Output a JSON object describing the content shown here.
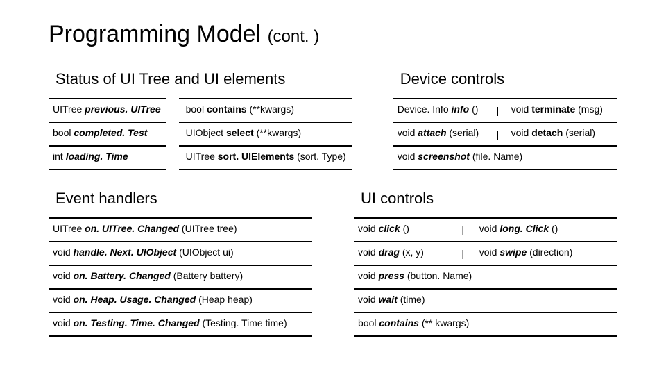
{
  "title_main": "Programming Model ",
  "title_cont": "(cont. )",
  "sections": {
    "status_title": "Status of UI Tree and UI elements",
    "device_title": "Device controls",
    "event_title": "Event handlers",
    "uicontrols_title": "UI controls"
  },
  "status": [
    {
      "l_pre": "UITree ",
      "l_bi": "previous. UITree",
      "l_post": "",
      "r_pre": "bool ",
      "r_b": "contains ",
      "r_post": "(**kwargs)"
    },
    {
      "l_pre": "bool ",
      "l_bi": "completed. Test",
      "l_post": "",
      "r_pre": "UIObject ",
      "r_b": "select ",
      "r_post": "(**kwargs)"
    },
    {
      "l_pre": "int ",
      "l_bi": "loading. Time",
      "l_post": "",
      "r_pre": "UITree ",
      "r_b": "sort. UIElements ",
      "r_post": "(sort. Type)"
    }
  ],
  "device": [
    {
      "a_pre": "Device. Info ",
      "a_bi": "info ",
      "a_post": "()",
      "pipe": "|",
      "b_pre": "void ",
      "b_b": "terminate ",
      "b_post": "(msg)"
    },
    {
      "a_pre": "void ",
      "a_bi": "attach ",
      "a_post": "(serial)",
      "pipe": "|",
      "b_pre": "void ",
      "b_b": "detach ",
      "b_post": "(serial)"
    },
    {
      "a_pre": "void ",
      "a_bi": "screenshot ",
      "a_post": "(file. Name)",
      "pipe": "",
      "b_pre": "",
      "b_b": "",
      "b_post": ""
    }
  ],
  "events": [
    {
      "pre": "UITree ",
      "bi": "on. UITree. Changed ",
      "post": "(UITree tree)"
    },
    {
      "pre": "void ",
      "bi": "handle. Next. UIObject ",
      "post": "(UIObject ui)"
    },
    {
      "pre": "void ",
      "bi": "on. Battery. Changed ",
      "post": "(Battery battery)"
    },
    {
      "pre": "void ",
      "bi": "on. Heap. Usage. Changed ",
      "post": "(Heap heap)"
    },
    {
      "pre": "void ",
      "bi": "on. Testing. Time. Changed ",
      "post": "(Testing. Time time)"
    }
  ],
  "uicontrols": [
    {
      "a_pre": "void ",
      "a_bi": "click ",
      "a_post": "()",
      "pipe": "|",
      "b_pre": " void ",
      "b_bi": "long. Click ",
      "b_post": "()"
    },
    {
      "a_pre": "void ",
      "a_bi": "drag ",
      "a_post": "(x, y)",
      "pipe": "|",
      "b_pre": "void ",
      "b_bi": "swipe ",
      "b_post": "(direction)"
    },
    {
      "a_pre": "void ",
      "a_bi": "press ",
      "a_post": "(button. Name)",
      "pipe": "",
      "b_pre": "",
      "b_bi": "",
      "b_post": ""
    },
    {
      "a_pre": "void ",
      "a_bi": "wait ",
      "a_post": "(time)",
      "pipe": "",
      "b_pre": "",
      "b_bi": "",
      "b_post": ""
    },
    {
      "a_pre": "bool ",
      "a_bi": "contains ",
      "a_post": "(** kwargs)",
      "pipe": "",
      "b_pre": "",
      "b_bi": "",
      "b_post": ""
    }
  ]
}
